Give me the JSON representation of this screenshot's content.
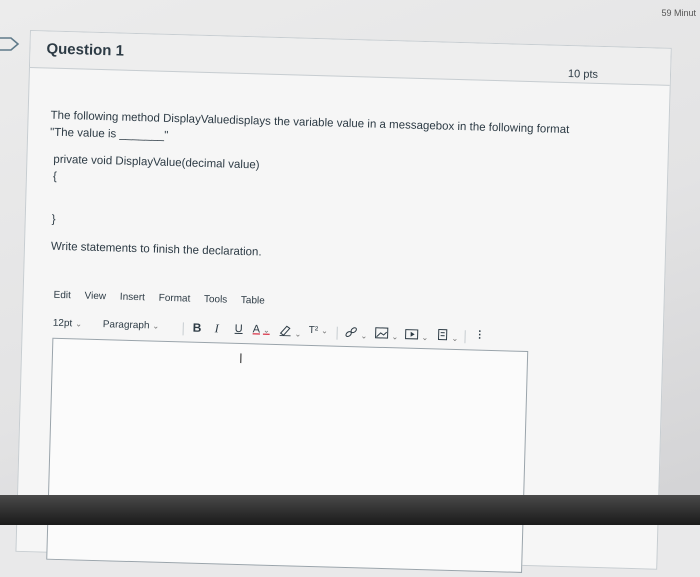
{
  "timer_text": "59 Minut",
  "question": {
    "title": "Question 1",
    "points": "10 pts",
    "prompt_line1": "The following method DisplayValuedisplays the variable value in a messagebox in the following format",
    "prompt_line2": "\"The value is _______\"",
    "code_signature": "private void DisplayValue(decimal value)",
    "code_open_brace": "{",
    "code_close_brace": "}",
    "instruction": "Write statements to finish the declaration."
  },
  "editor": {
    "menu": [
      "Edit",
      "View",
      "Insert",
      "Format",
      "Tools",
      "Table"
    ],
    "font_size": "12pt",
    "block_format": "Paragraph",
    "bold_label": "B",
    "italic_label": "I",
    "underline_label": "U",
    "text_color_label": "A",
    "superscript_label": "T²",
    "more_label": "⋮",
    "chevron": "⌄",
    "cursor_glyph": "I"
  },
  "colors": {
    "text": "#2d3b45",
    "border": "#c7cdd1",
    "editor_border": "#9aa4ab",
    "icon": "#555555"
  }
}
